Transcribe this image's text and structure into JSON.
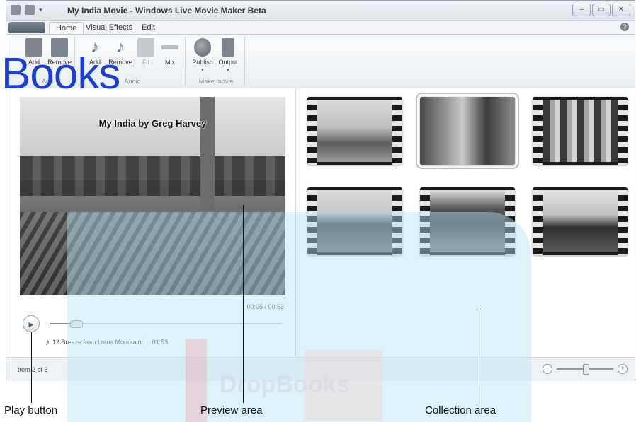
{
  "window": {
    "title": "My India Movie - Windows Live Movie Maker Beta",
    "controls": [
      "–",
      "▭",
      "✕"
    ]
  },
  "tabs": [
    {
      "label": "Home",
      "active": true
    },
    {
      "label": "Visual Effects",
      "active": false
    },
    {
      "label": "Edit",
      "active": false
    }
  ],
  "ribbon": {
    "groups": [
      {
        "label": "Add",
        "buttons": [
          "Add",
          "Remove"
        ]
      },
      {
        "label": "Audio",
        "buttons": [
          "Add",
          "Remove",
          "Fit",
          "Mix"
        ]
      },
      {
        "label": "Make movie",
        "buttons": [
          "Publish",
          "Output"
        ]
      }
    ]
  },
  "overlay_brand": "Books",
  "preview": {
    "video_title": "My India by Greg Harvey",
    "timecode": "00:05 / 00:53",
    "seek_progress": 0.11,
    "audio_track": "12 Breeze from Lotus Mountain",
    "audio_duration": "01:53"
  },
  "collection": {
    "clips": [
      {
        "selected": false
      },
      {
        "selected": true
      },
      {
        "selected": false
      },
      {
        "selected": false
      },
      {
        "selected": false
      },
      {
        "selected": false
      }
    ]
  },
  "status": {
    "item_text": "Item 2 of 6",
    "zoom_level": 0.5
  },
  "watermark_text": "DropBooks",
  "callouts": {
    "play": "Play button",
    "preview": "Preview area",
    "collection": "Collection area"
  },
  "colors": {
    "brand_overlay": "#1a3fd0",
    "watermark": "#b4e5f0"
  }
}
